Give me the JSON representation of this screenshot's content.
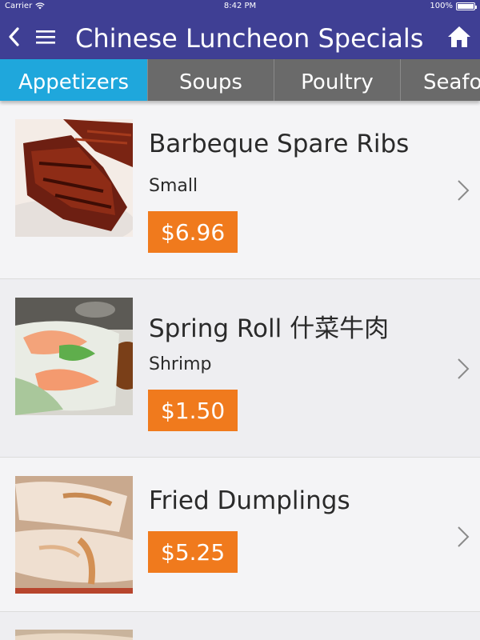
{
  "status": {
    "carrier": "Carrier",
    "time": "8:42 PM",
    "battery": "100%"
  },
  "nav": {
    "title": "Chinese Luncheon Specials"
  },
  "tabs": [
    {
      "label": "Appetizers",
      "active": true
    },
    {
      "label": "Soups",
      "active": false
    },
    {
      "label": "Poultry",
      "active": false
    },
    {
      "label": "Seafood",
      "active": false
    }
  ],
  "items": [
    {
      "name": "Barbeque Spare Ribs",
      "size": "Small",
      "price": "$6.96"
    },
    {
      "name": "Spring Roll 什菜牛肉",
      "size": "Shrimp",
      "price": "$1.50"
    },
    {
      "name": "Fried Dumplings",
      "size": "",
      "price": "$5.25"
    }
  ],
  "colors": {
    "nav_bar": "#3f3f94",
    "tab_active": "#1fa7dc",
    "tab_inactive": "#6a6a6a",
    "price_badge": "#f07a1d"
  }
}
